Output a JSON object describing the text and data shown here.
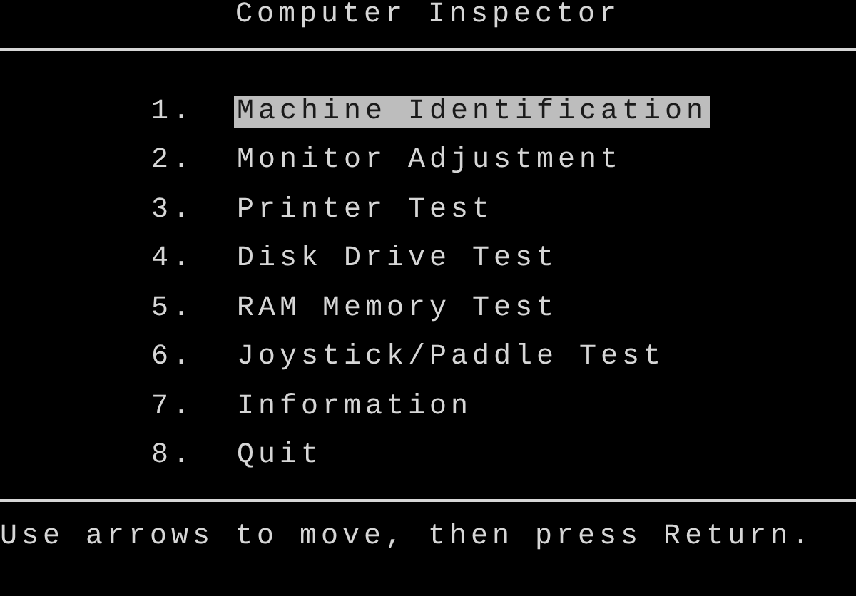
{
  "title": "Computer Inspector",
  "menu": [
    {
      "number": "1.",
      "label": "Machine Identification",
      "selected": true
    },
    {
      "number": "2.",
      "label": "Monitor Adjustment",
      "selected": false
    },
    {
      "number": "3.",
      "label": "Printer Test",
      "selected": false
    },
    {
      "number": "4.",
      "label": "Disk Drive Test",
      "selected": false
    },
    {
      "number": "5.",
      "label": "RAM Memory Test",
      "selected": false
    },
    {
      "number": "6.",
      "label": "Joystick/Paddle Test",
      "selected": false
    },
    {
      "number": "7.",
      "label": "Information",
      "selected": false
    },
    {
      "number": "8.",
      "label": "Quit",
      "selected": false
    }
  ],
  "status_bar": "Use arrows to move, then press Return."
}
